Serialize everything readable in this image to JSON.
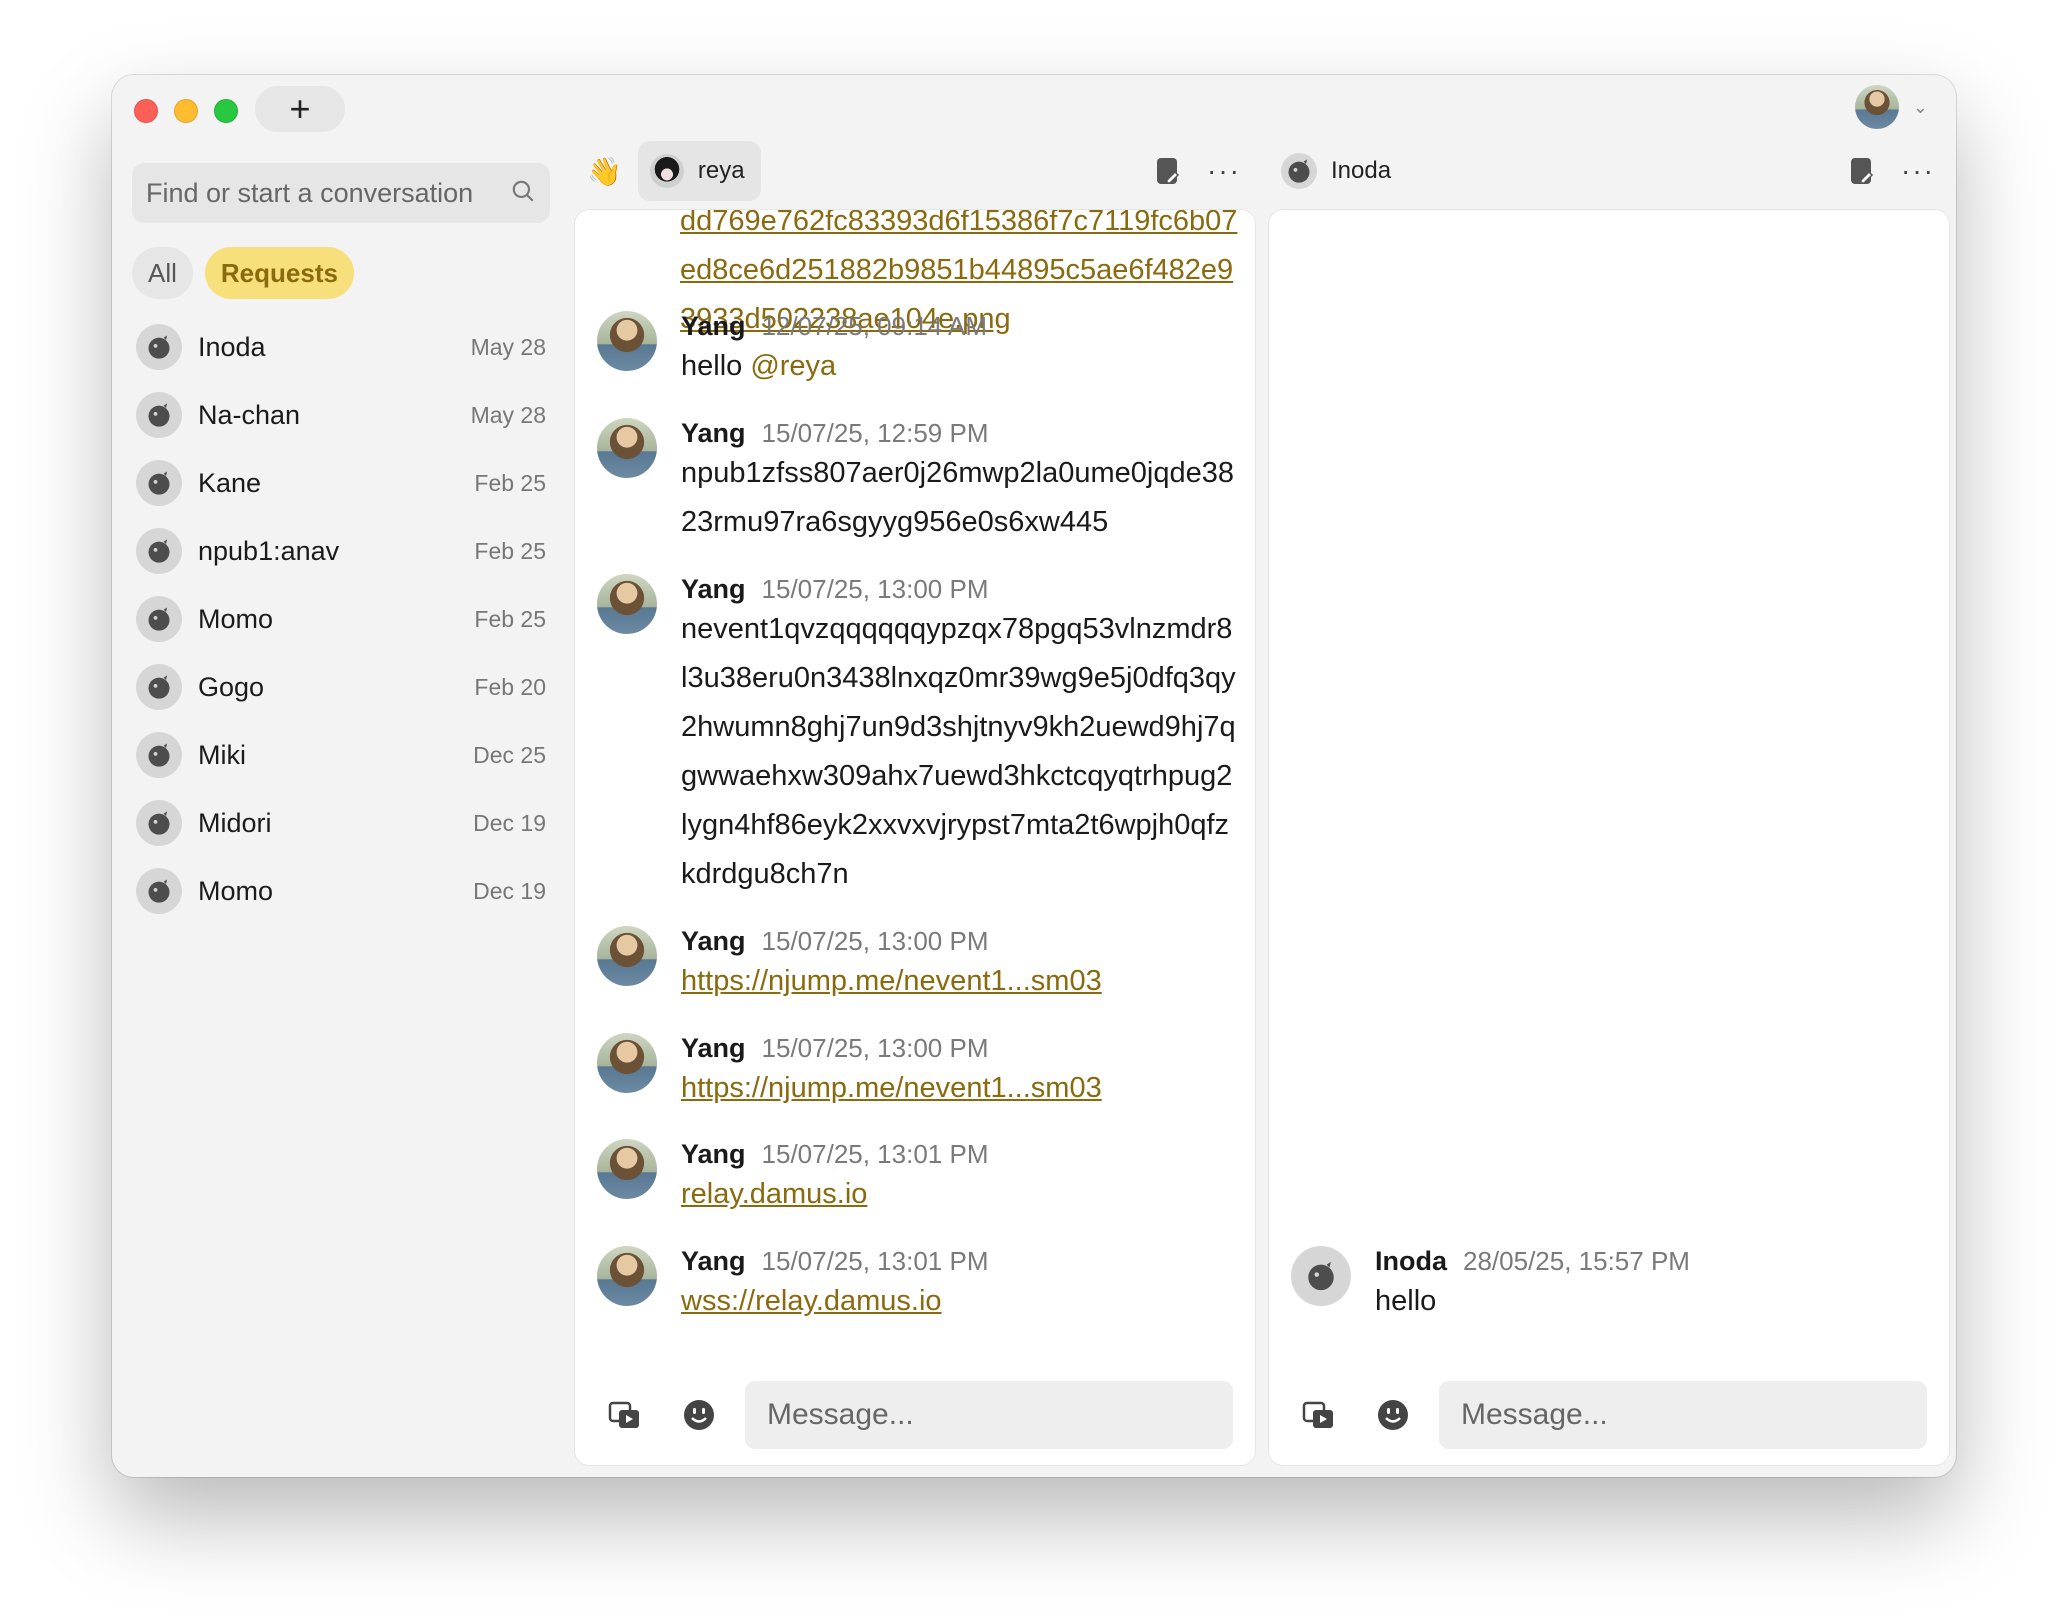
{
  "window": {
    "new_button": "+",
    "search_placeholder": "Find or start a conversation"
  },
  "filters": {
    "all": "All",
    "requests": "Requests"
  },
  "conversations": [
    {
      "name": "Inoda",
      "date": "May 28"
    },
    {
      "name": "Na-chan",
      "date": "May 28"
    },
    {
      "name": "Kane",
      "date": "Feb 25"
    },
    {
      "name": "npub1:anav",
      "date": "Feb 25"
    },
    {
      "name": "Momo",
      "date": "Feb 25"
    },
    {
      "name": "Gogo",
      "date": "Feb 20"
    },
    {
      "name": "Miki",
      "date": "Dec 25"
    },
    {
      "name": "Midori",
      "date": "Dec 19"
    },
    {
      "name": "Momo",
      "date": "Dec 19"
    }
  ],
  "panel_a": {
    "wave": "👋",
    "title": "reya",
    "top_link": "dd769e762fc83393d6f15386f7c7119fc6b07ed8ce6d251882b9851b44895c5ae6f482e93933d502238ae104e.png",
    "messages": [
      {
        "author": "Yang",
        "time": "12/07/25, 09:14 AM",
        "text": "hello ",
        "mention": "@reya"
      },
      {
        "author": "Yang",
        "time": "15/07/25, 12:59 PM",
        "text": "npub1zfss807aer0j26mwp2la0ume0jqde3823rmu97ra6sgyyg956e0s6xw445"
      },
      {
        "author": "Yang",
        "time": "15/07/25, 13:00 PM",
        "text": "nevent1qvzqqqqqqypzqx78pgq53vlnzmdr8l3u38eru0n3438lnxqz0mr39wg9e5j0dfq3qy2hwumn8ghj7un9d3shjtnyv9kh2uewd9hj7qgwwaehxw309ahx7uewd3hkctcqyqtrhpug2lygn4hf86eyk2xxvxvjrypst7mta2t6wpjh0qfzkdrdgu8ch7n"
      },
      {
        "author": "Yang",
        "time": "15/07/25, 13:00 PM",
        "link": "https://njump.me/nevent1...sm03"
      },
      {
        "author": "Yang",
        "time": "15/07/25, 13:00 PM",
        "link": "https://njump.me/nevent1...sm03"
      },
      {
        "author": "Yang",
        "time": "15/07/25, 13:01 PM",
        "link": "relay.damus.io"
      },
      {
        "author": "Yang",
        "time": "15/07/25, 13:01 PM",
        "link": "wss://relay.damus.io"
      }
    ],
    "composer_placeholder": "Message..."
  },
  "panel_b": {
    "title": "Inoda",
    "messages": [
      {
        "author": "Inoda",
        "time": "28/05/25, 15:57 PM",
        "text": "hello"
      }
    ],
    "composer_placeholder": "Message..."
  },
  "colors": {
    "accent": "#8a6a0e",
    "chip_active_bg": "#f7df7c"
  }
}
